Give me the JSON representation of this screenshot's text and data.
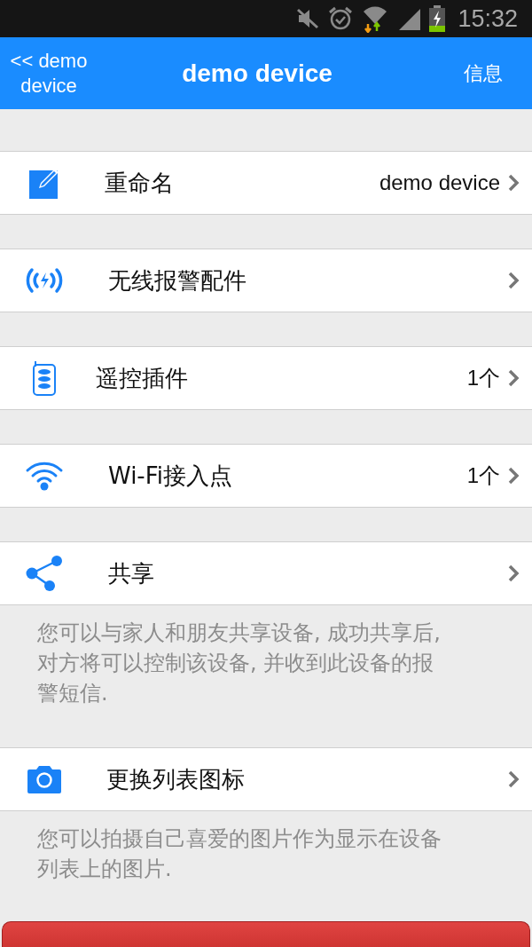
{
  "status_bar": {
    "time": "15:32"
  },
  "nav": {
    "back": "<< demo device",
    "title": "demo device",
    "action": "信息"
  },
  "sections": [
    {
      "label": "重命名",
      "value": "demo device"
    },
    {
      "label": "无线报警配件"
    },
    {
      "label": "遥控插件",
      "value": "1个"
    },
    {
      "label": "Wi-Fi接入点",
      "value": "1个"
    },
    {
      "label": "共享",
      "note": "您可以与家人和朋友共享设备, 成功共享后, 对方将可以控制该设备, 并收到此设备的报警短信."
    },
    {
      "label": "更换列表图标",
      "note": "您可以拍摄自己喜爱的图片作为显示在设备列表上的图片."
    }
  ]
}
